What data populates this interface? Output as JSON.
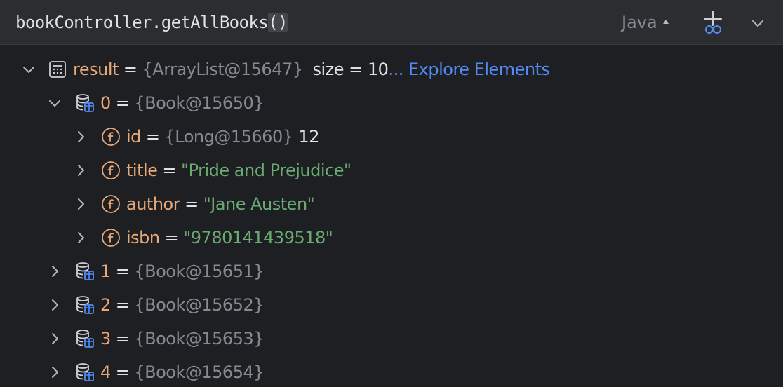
{
  "header": {
    "expression": "bookController.getAllBooks",
    "expression_parens": "()",
    "language": "Java",
    "watch_icon": "add-watch-icon",
    "more_icon": "chevron-down-icon"
  },
  "tree": {
    "result": {
      "name": "result",
      "eq": "=",
      "ref": "{ArrayList@15647}",
      "size_text": "size = 10",
      "ellipsis": "...",
      "link": "Explore Elements",
      "icon": "list-icon"
    },
    "item0": {
      "name": "0",
      "eq": "=",
      "ref": "{Book@15650}",
      "icon": "database-table-icon"
    },
    "fields": [
      {
        "name": "id",
        "eq": "=",
        "ref": "{Long@15660}",
        "value": "12"
      },
      {
        "name": "title",
        "eq": "=",
        "value": "\"Pride and Prejudice\""
      },
      {
        "name": "author",
        "eq": "=",
        "value": "\"Jane Austen\""
      },
      {
        "name": "isbn",
        "eq": "=",
        "value": "\"9780141439518\""
      }
    ],
    "items": [
      {
        "name": "1",
        "eq": "=",
        "ref": "{Book@15651}"
      },
      {
        "name": "2",
        "eq": "=",
        "ref": "{Book@15652}"
      },
      {
        "name": "3",
        "eq": "=",
        "ref": "{Book@15653}"
      },
      {
        "name": "4",
        "eq": "=",
        "ref": "{Book@15654}"
      }
    ],
    "field_icon": "field-icon"
  },
  "colors": {
    "background": "#1e1f22",
    "header_bg": "#2b2d30",
    "name": "#e8a878",
    "reference": "#868a91",
    "string": "#6aab73",
    "link": "#548af7",
    "text": "#dfe1e5"
  }
}
